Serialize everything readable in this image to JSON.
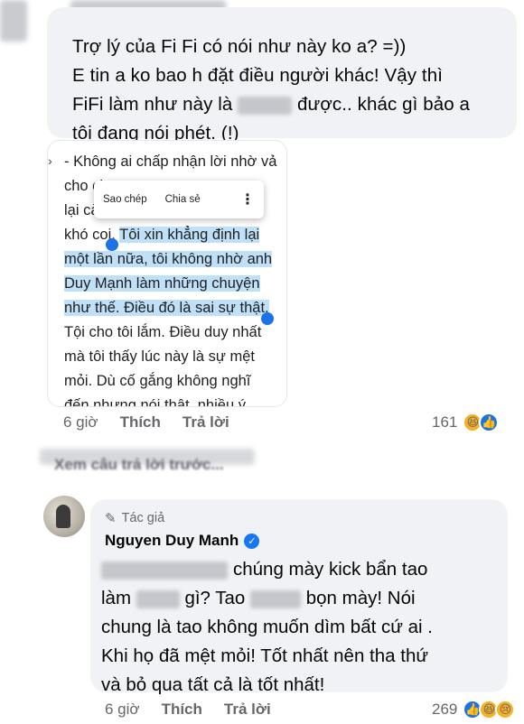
{
  "comment1": {
    "lines": [
      "Trợ lý của Fi Fi có nói như này ko a? =))",
      "E tin a ko bao h đặt điều người khác! Vậy thì",
      "tôi đang nói phét. (!)"
    ],
    "line3_pre": "FiFi làm như này là",
    "line3_post": "được.. khác gì bảo a",
    "time": "6 giờ",
    "like": "Thích",
    "reply": "Trả lời",
    "reaction_count": "161"
  },
  "attachment": {
    "lines": [
      "- Không ai chấp nhận lời nhờ vả",
      "cho chu",
      "lại càng",
      "khó coi.",
      "Tôi xin khẳng định lại",
      "một lần nữa, tôi không nhờ anh",
      "Duy Mạnh làm những chuyện",
      "như thế. Điều đó là sai sự thật.",
      "Tội cho tôi lắm. Điều duy nhất",
      "mà tôi thấy lúc này là sự mệt",
      "mỏi. Dù cố gắng không nghĩ",
      "đến nhưng nói thật, nhiều ý"
    ],
    "menu": {
      "copy": "Sao chép",
      "share": "Chia sẻ"
    }
  },
  "prev_replies_label": "Xem câu trả lời trước...",
  "comment2": {
    "badge": "Tác giả",
    "author": "Nguyen Duy Manh",
    "line1": "chúng mày kick bẩn tao",
    "line2_pre": "làm",
    "line2_mid": "gì? Tao",
    "line2_post": "bọn mày! Nói",
    "lines": [
      "chung là tao không muốn dìm bất cứ ai .",
      "Khi họ đã mệt mỏi! Tốt nhất nên tha thứ",
      "và bỏ qua tất cả là tốt nhất!"
    ],
    "time": "6 giờ",
    "like": "Thích",
    "reply": "Trả lời",
    "reaction_count": "269"
  },
  "colors": {
    "bubble": "#f0f2f5",
    "highlight": "#bfe0f7",
    "verified": "#1877f2",
    "meta": "#65676b"
  }
}
